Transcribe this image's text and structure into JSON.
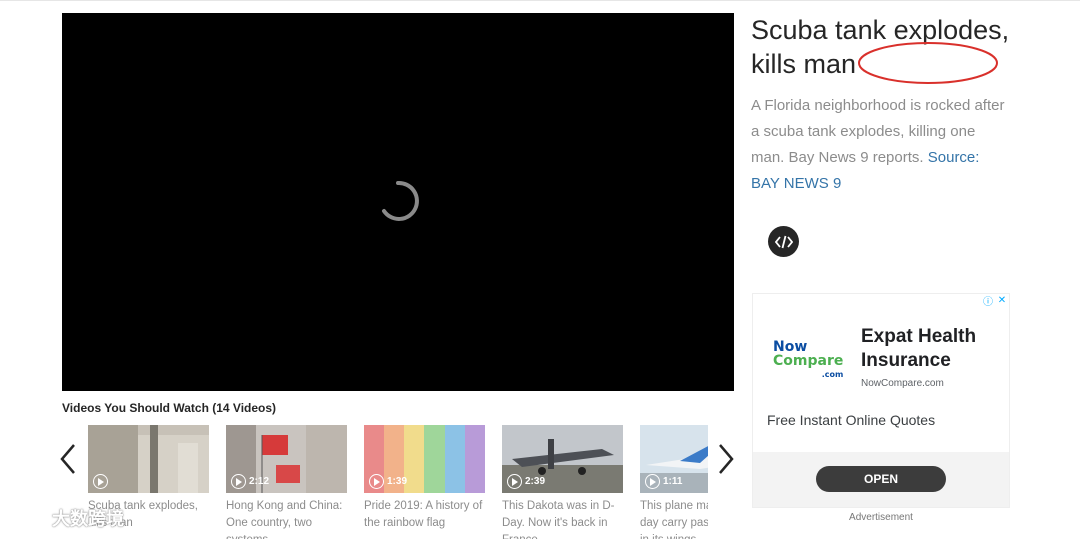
{
  "headline": {
    "text": "Scuba tank explodes, kills man"
  },
  "description": {
    "text": "A Florida neighborhood is rocked after a scuba tank explodes, killing one man. Bay News 9 reports.",
    "source_link": "Source: BAY NEWS 9"
  },
  "carousel": {
    "title": "Videos You Should Watch (14 Videos)",
    "items": [
      {
        "caption": "Scuba tank explodes, kills man",
        "duration": "",
        "thumb_color": "#9a9082"
      },
      {
        "caption": "Hong Kong and China: One country, two systems",
        "duration": "2:12",
        "thumb_color": "#b9b3ad"
      },
      {
        "caption": "Pride 2019: A history of the rainbow flag",
        "duration": "1:39",
        "thumb_color": "#e58a8a"
      },
      {
        "caption": "This Dakota was in D-Day. Now it's back in France",
        "duration": "2:39",
        "thumb_color": "#8d8f92"
      },
      {
        "caption": "This plane may one day carry passengers in its wings",
        "duration": "1:11",
        "thumb_color": "#c7d6e2"
      }
    ]
  },
  "ad": {
    "logo_line1": "Now",
    "logo_line2": "Compare",
    "logo_line3": ".com",
    "title": "Expat Health Insurance",
    "domain": "NowCompare.com",
    "body": "Free Instant Online Quotes",
    "cta": "OPEN",
    "label": "Advertisement",
    "choices_info": "ⓘ",
    "choices_close": "✕"
  },
  "watermark": {
    "text": "大数跨境"
  },
  "colors": {
    "player_bg": "#000000",
    "link": "#3474a8",
    "annotation_circle": "#d9302b"
  }
}
